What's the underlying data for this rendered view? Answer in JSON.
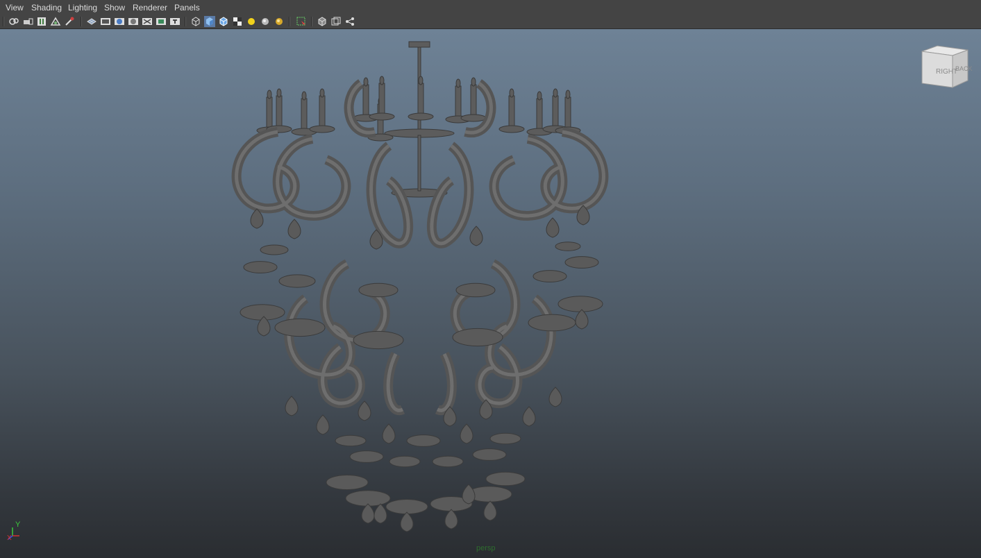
{
  "menubar": {
    "items": [
      {
        "label": "View"
      },
      {
        "label": "Shading"
      },
      {
        "label": "Lighting"
      },
      {
        "label": "Show"
      },
      {
        "label": "Renderer"
      },
      {
        "label": "Panels"
      }
    ]
  },
  "toolbar": {
    "icons": [
      "select-camera-icon",
      "lock-camera-icon",
      "camera-attributes-icon",
      "image-plane-icon",
      "grease-pencil-icon",
      "bookmark-icon",
      "grid-icon",
      "film-gate-icon",
      "resolution-gate-icon",
      "gate-mask-icon",
      "field-chart-icon",
      "safe-action-icon",
      "safe-title-icon",
      "wireframe-icon",
      "smooth-shade-icon",
      "wireframe-on-shaded-icon",
      "textured-icon",
      "default-light-icon",
      "shadows-icon",
      "ambient-occlusion-icon",
      "isolate-select-icon",
      "xray-icon",
      "xray-joints-icon",
      "xray-components-icon"
    ]
  },
  "viewport": {
    "camera_label": "persp",
    "viewcube": {
      "face_right": "RIGHT",
      "face_back": "BACK"
    },
    "axis": {
      "y": "Y",
      "x": "X"
    },
    "colors": {
      "top": "#6e8296",
      "bottom": "#2a2d31",
      "model": "#5e5e5e",
      "axis_y": "#3cc83c",
      "axis_x": "#d23232",
      "axis_z": "#3c50e6"
    }
  }
}
